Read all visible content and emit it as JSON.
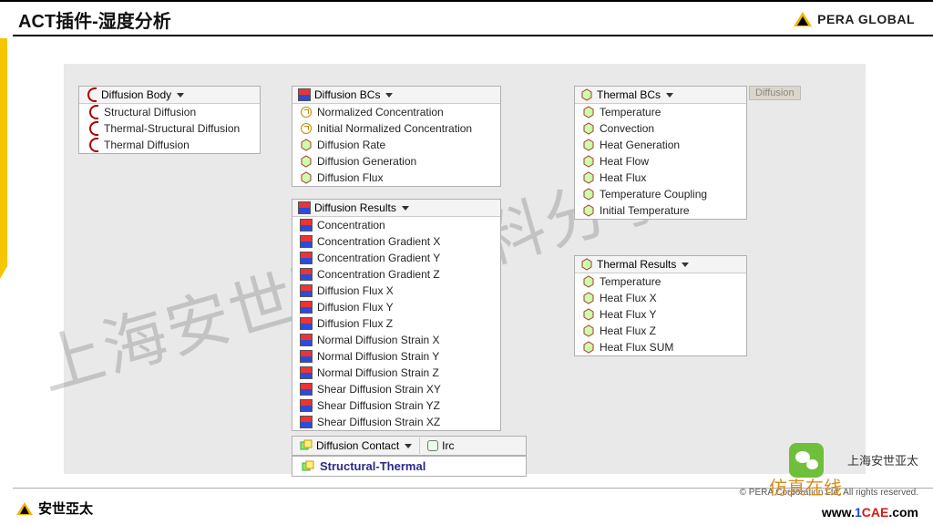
{
  "header": {
    "title": "ACT插件-湿度分析",
    "brand": "PERA GLOBAL"
  },
  "watermark": "上海安世亚太资料分享",
  "panels": {
    "diffusion_body": {
      "title": "Diffusion Body",
      "items": [
        "Structural Diffusion",
        "Thermal-Structural Diffusion",
        "Thermal Diffusion"
      ]
    },
    "diffusion_bcs": {
      "title": "Diffusion BCs",
      "items": [
        "Normalized Concentration",
        "Initial Normalized Concentration",
        "Diffusion Rate",
        "Diffusion Generation",
        "Diffusion Flux"
      ]
    },
    "diffusion_results": {
      "title": "Diffusion Results",
      "items": [
        "Concentration",
        "Concentration Gradient X",
        "Concentration Gradient Y",
        "Concentration Gradient Z",
        "Diffusion Flux X",
        "Diffusion Flux Y",
        "Diffusion Flux Z",
        "Normal Diffusion Strain X",
        "Normal Diffusion Strain Y",
        "Normal Diffusion Strain Z",
        "Shear Diffusion Strain XY",
        "Shear Diffusion Strain YZ",
        "Shear Diffusion Strain XZ"
      ]
    },
    "thermal_bcs": {
      "title": "Thermal BCs",
      "tag": "Diffusion",
      "items": [
        "Temperature",
        "Convection",
        "Heat Generation",
        "Heat Flow",
        "Heat Flux",
        "Temperature Coupling",
        "Initial Temperature"
      ]
    },
    "thermal_results": {
      "title": "Thermal Results",
      "items": [
        "Temperature",
        "Heat Flux X",
        "Heat Flux Y",
        "Heat Flux Z",
        "Heat Flux SUM"
      ]
    },
    "diffusion_contact": {
      "title": "Diffusion Contact",
      "extra": "Irc",
      "sub": "Structural-Thermal"
    }
  },
  "footer": {
    "brand_cn": "安世亞太",
    "copyright": "©  PERA Corporation Ltd. All rights reserved.",
    "wechat_label": "上海安世亚太",
    "fzzx": "仿真在线",
    "link": "www.1CAE.com"
  }
}
